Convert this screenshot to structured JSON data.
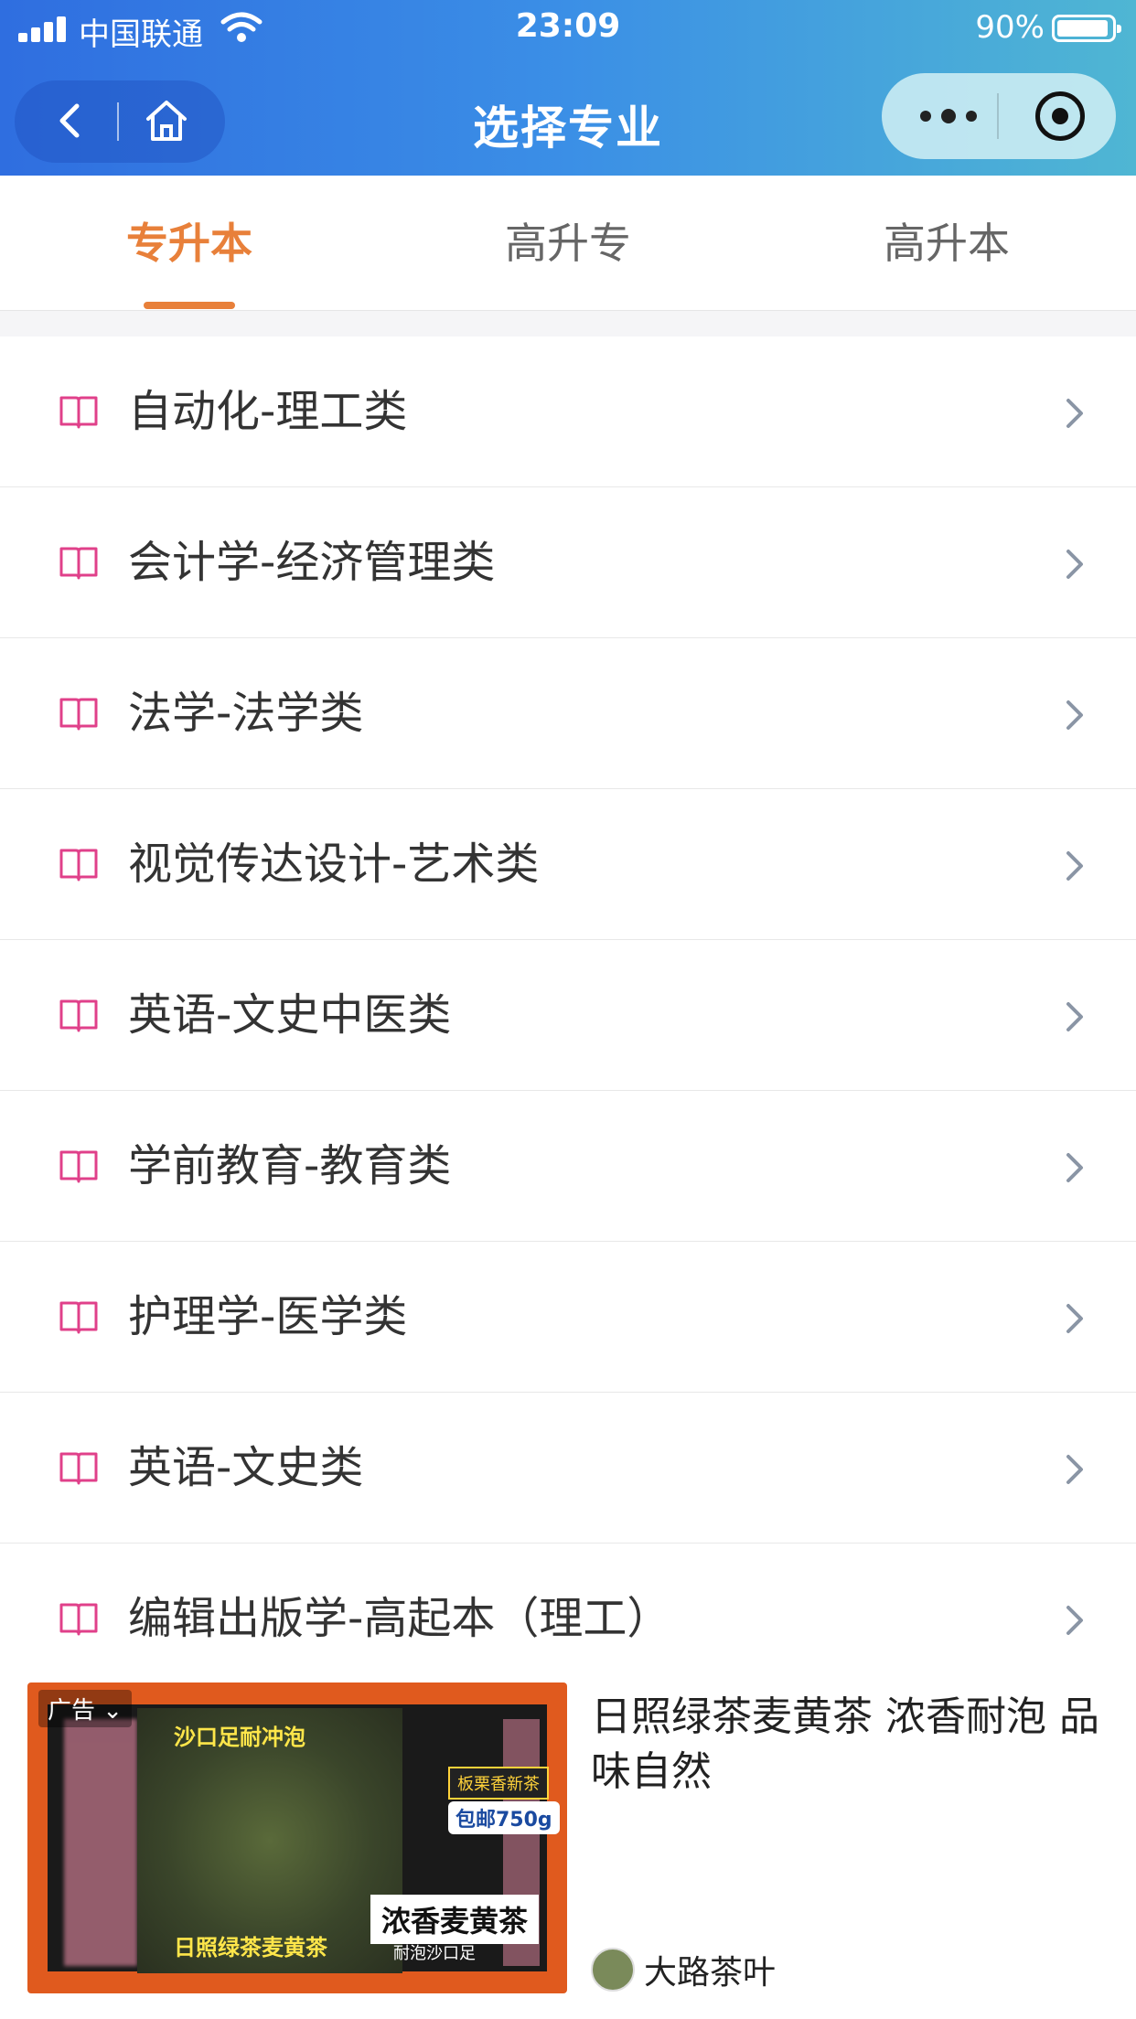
{
  "status_bar": {
    "carrier": "中国联通",
    "time": "23:09",
    "battery": "90%"
  },
  "nav": {
    "title": "选择专业"
  },
  "tabs": [
    {
      "label": "专升本",
      "active": true
    },
    {
      "label": "高升专",
      "active": false
    },
    {
      "label": "高升本",
      "active": false
    }
  ],
  "majors": [
    "自动化-理工类",
    "会计学-经济管理类",
    "法学-法学类",
    "视觉传达设计-艺术类",
    "英语-文史中医类",
    "学前教育-教育类",
    "护理学-医学类",
    "英语-文史类",
    "编辑出版学-高起本（理工）"
  ],
  "ad": {
    "tag": "广告 ⌄",
    "title": "日照绿茶麦黄茶 浓香耐泡 品味自然",
    "brand": "大路茶叶",
    "image_captions": {
      "top": "沙口足耐冲泡",
      "badge1": "板栗香新茶",
      "badge2": "包邮750g",
      "big": "浓香麦黄茶",
      "bottom": "日照绿茶麦黄茶",
      "foot": "耐泡沙口足"
    }
  },
  "colors": {
    "accent": "#e8803a",
    "icon_pink": "#e0408a",
    "header_start": "#2f6ee0",
    "header_end": "#4fb6d3"
  }
}
